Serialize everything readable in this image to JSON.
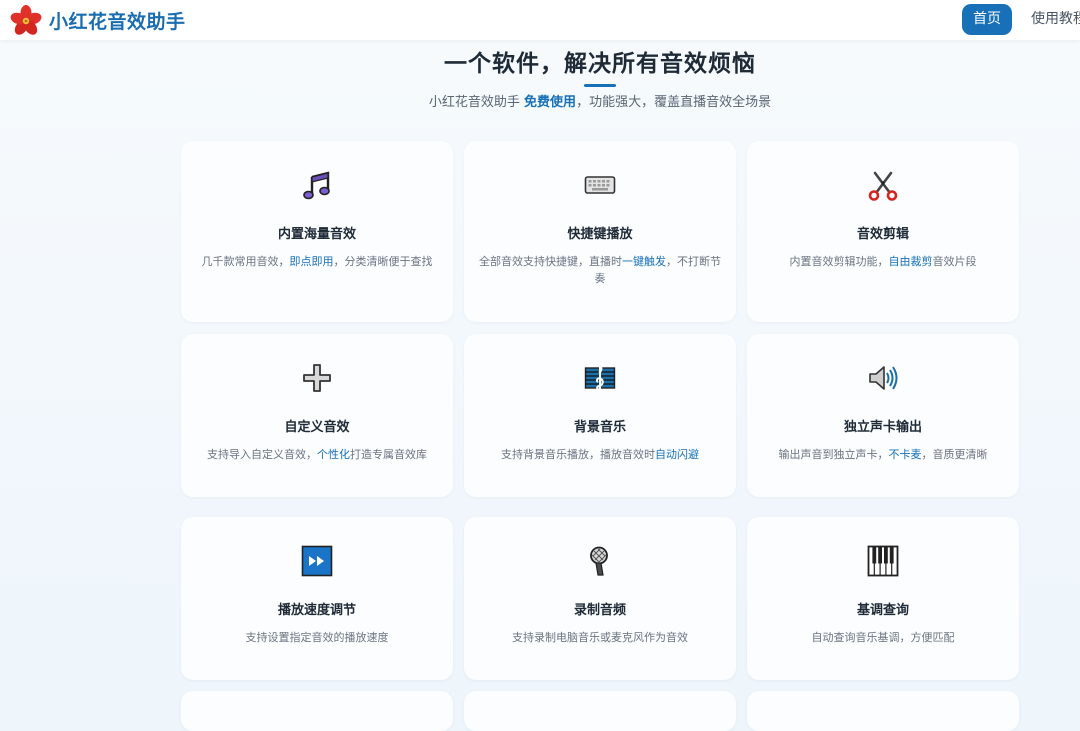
{
  "navbar": {
    "brand": "小红花音效助手",
    "home_label": "首页",
    "tutorial_label": "使用教程"
  },
  "hero": {
    "title": "一个软件，解决所有音效烦恼",
    "subtitle_before": "小红花音效助手 ",
    "subtitle_highlight": "免费使用",
    "subtitle_after": "，功能强大，覆盖直播音效全场景"
  },
  "colors": {
    "accent": "#1770b8",
    "title": "#1f2a37",
    "text": "#6b7482"
  },
  "features": [
    {
      "icon": "musical-notes-icon",
      "title": "内置海量音效",
      "desc_before": "几千款常用音效，",
      "desc_highlight": "即点即用",
      "desc_after": "，分类清晰便于查找"
    },
    {
      "icon": "keyboard-icon",
      "title": "快捷键播放",
      "desc_before": "全部音效支持快捷键，直播时",
      "desc_highlight": "一键触发",
      "desc_after": "，不打断节奏"
    },
    {
      "icon": "scissors-icon",
      "title": "音效剪辑",
      "desc_before": "内置音效剪辑功能，",
      "desc_highlight": "自由裁剪",
      "desc_after": "音效片段"
    },
    {
      "icon": "plus-icon",
      "title": "自定义音效",
      "desc_before": "支持导入自定义音效，",
      "desc_highlight": "个性化",
      "desc_after": "打造专属音效库"
    },
    {
      "icon": "music-score-icon",
      "title": "背景音乐",
      "desc_before": "支持背景音乐播放，播放音效时",
      "desc_highlight": "自动闪避",
      "desc_after": ""
    },
    {
      "icon": "speaker-icon",
      "title": "独立声卡输出",
      "desc_before": "输出声音到独立声卡，",
      "desc_highlight": "不卡麦",
      "desc_after": "，音质更清晰"
    },
    {
      "icon": "fast-forward-icon",
      "title": "播放速度调节",
      "desc_before": "支持设置指定音效的播放速度",
      "desc_highlight": "",
      "desc_after": ""
    },
    {
      "icon": "microphone-icon",
      "title": "录制音频",
      "desc_before": "支持录制电脑音乐或麦克风作为音效",
      "desc_highlight": "",
      "desc_after": ""
    },
    {
      "icon": "piano-keys-icon",
      "title": "基调查询",
      "desc_before": "自动查询音乐基调，方便匹配",
      "desc_highlight": "",
      "desc_after": ""
    }
  ]
}
